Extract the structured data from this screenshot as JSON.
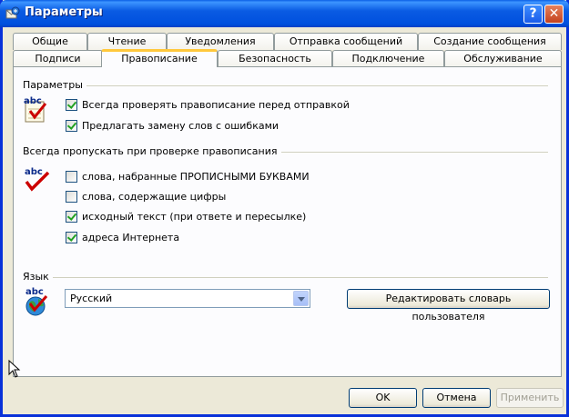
{
  "window": {
    "title": "Параметры"
  },
  "titlebar": {
    "help_label": "?",
    "close_label": "✕"
  },
  "tabs": {
    "row1": [
      "Общие",
      "Чтение",
      "Уведомления",
      "Отправка сообщений",
      "Создание сообщения"
    ],
    "row2": [
      "Подписи",
      "Правописание",
      "Безопасность",
      "Подключение",
      "Обслуживание"
    ],
    "active": "Правописание"
  },
  "settings": {
    "label": "Параметры",
    "items": [
      {
        "label": "Всегда проверять правописание перед отправкой",
        "checked": true
      },
      {
        "label": "Предлагать замену слов с ошибками",
        "checked": true
      }
    ]
  },
  "ignore": {
    "label": "Всегда пропускать при проверке правописания",
    "items": [
      {
        "label": "слова, набранные ПРОПИСНЫМИ БУКВАМИ",
        "checked": false
      },
      {
        "label": "слова, содержащие цифры",
        "checked": false
      },
      {
        "label": "исходный текст (при ответе и пересылке)",
        "checked": true
      },
      {
        "label": "адреса Интернета",
        "checked": true
      }
    ]
  },
  "language": {
    "label": "Язык",
    "selected": "Русский",
    "edit_dictionary_label": "Редактировать словарь пользователя"
  },
  "icons": {
    "spell": "abc",
    "check_color": "#cc0000"
  },
  "footer": {
    "ok_label": "OK",
    "cancel_label": "Отмена",
    "apply_label": "Применить"
  }
}
